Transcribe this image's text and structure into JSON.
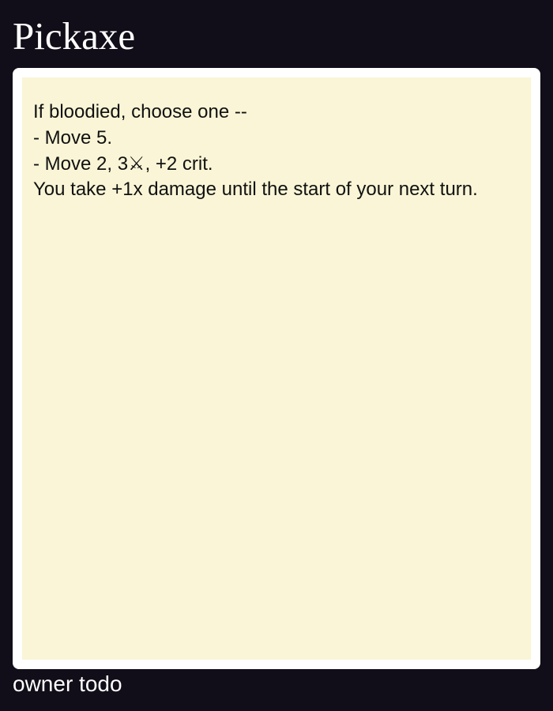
{
  "card": {
    "title": "Pickaxe",
    "lines": [
      "If bloodied, choose one --",
      "- Move 5.",
      "- Move 2, 3⚔, +2 crit.",
      "You take +1x damage until the start of your next turn."
    ],
    "owner": "owner todo"
  },
  "colors": {
    "page_background": "#110e19",
    "card_frame": "#ffffff",
    "card_body": "#f9f5d6",
    "title_text": "#ffffff",
    "body_text": "#111111"
  },
  "icons": {
    "damage_symbol": "crossed-swords-icon"
  }
}
